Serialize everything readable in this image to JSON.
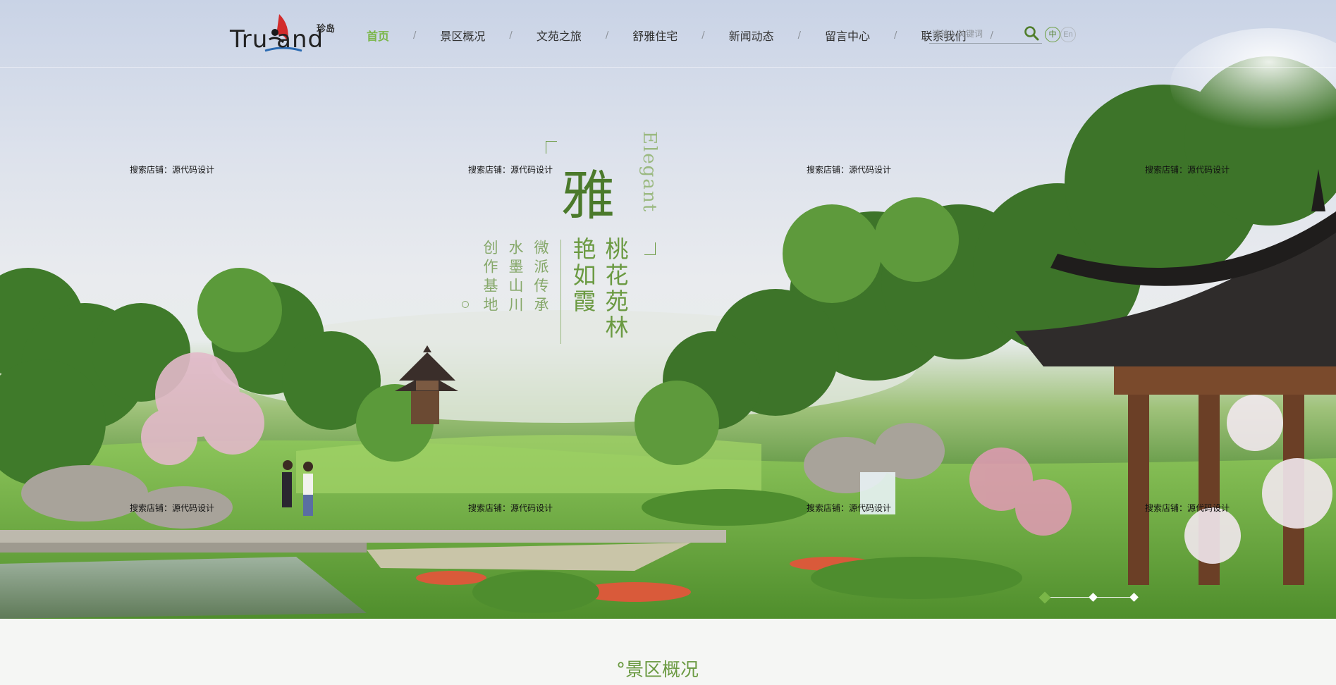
{
  "logo": {
    "text": "Tru  and",
    "cn": "珍岛"
  },
  "nav": {
    "items": [
      {
        "label": "首页",
        "active": true
      },
      {
        "label": "景区概况",
        "active": false
      },
      {
        "label": "文苑之旅",
        "active": false
      },
      {
        "label": "舒雅住宅",
        "active": false
      },
      {
        "label": "新闻动态",
        "active": false
      },
      {
        "label": "留言中心",
        "active": false
      },
      {
        "label": "联系我们",
        "active": false
      }
    ],
    "separator": "/"
  },
  "search": {
    "placeholder": "请输入关键词",
    "icon": "search-icon"
  },
  "lang": {
    "cn": "中",
    "en": "En"
  },
  "hero": {
    "big_char": "雅",
    "english": "Elegant",
    "line1": "桃花苑林",
    "line2": "艳如霞",
    "small1": "微派传承",
    "small2": "水墨山川",
    "small3": "创作基地"
  },
  "watermark": "搜索店铺：源代码设计",
  "slider": {
    "count": 3,
    "active_index": 0
  },
  "section": {
    "title": "°景区概况"
  },
  "colors": {
    "accent": "#7ab648",
    "nav_text": "#333333"
  }
}
